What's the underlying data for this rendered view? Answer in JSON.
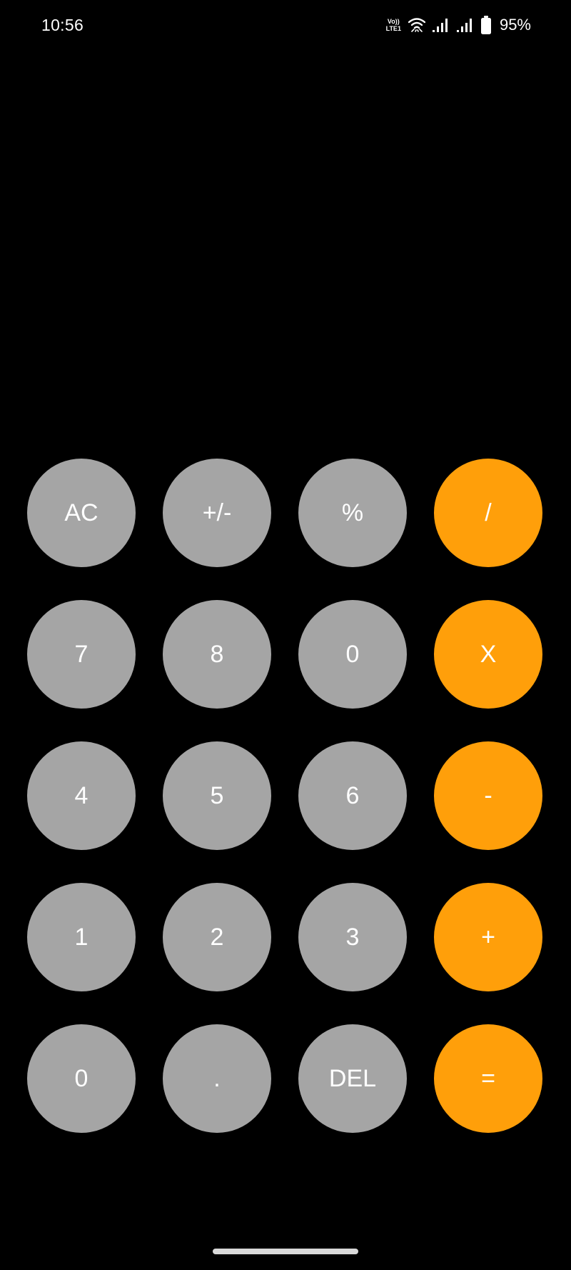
{
  "status_bar": {
    "time": "10:56",
    "volte_top": "Vo))",
    "volte_bottom": "LTE1",
    "battery_percent": "95%",
    "icons": [
      "volte-lte-icon",
      "wifi-icon",
      "signal-sim1-icon",
      "signal-sim2-icon",
      "battery-icon"
    ]
  },
  "display": {
    "value": ""
  },
  "keypad": {
    "rows": [
      [
        {
          "label": "AC",
          "kind": "function"
        },
        {
          "label": "+/-",
          "kind": "function"
        },
        {
          "label": "%",
          "kind": "function"
        },
        {
          "label": "/",
          "kind": "operator"
        }
      ],
      [
        {
          "label": "7",
          "kind": "digit"
        },
        {
          "label": "8",
          "kind": "digit"
        },
        {
          "label": "0",
          "kind": "digit"
        },
        {
          "label": "X",
          "kind": "operator"
        }
      ],
      [
        {
          "label": "4",
          "kind": "digit"
        },
        {
          "label": "5",
          "kind": "digit"
        },
        {
          "label": "6",
          "kind": "digit"
        },
        {
          "label": "-",
          "kind": "operator"
        }
      ],
      [
        {
          "label": "1",
          "kind": "digit"
        },
        {
          "label": "2",
          "kind": "digit"
        },
        {
          "label": "3",
          "kind": "digit"
        },
        {
          "label": "+",
          "kind": "operator"
        }
      ],
      [
        {
          "label": "0",
          "kind": "digit"
        },
        {
          "label": ".",
          "kind": "digit"
        },
        {
          "label": "DEL",
          "kind": "function"
        },
        {
          "label": "=",
          "kind": "operator"
        }
      ]
    ]
  },
  "colors": {
    "background": "#000000",
    "key_gray": "#a5a5a5",
    "key_orange": "#ff9f0a",
    "text": "#ffffff"
  }
}
